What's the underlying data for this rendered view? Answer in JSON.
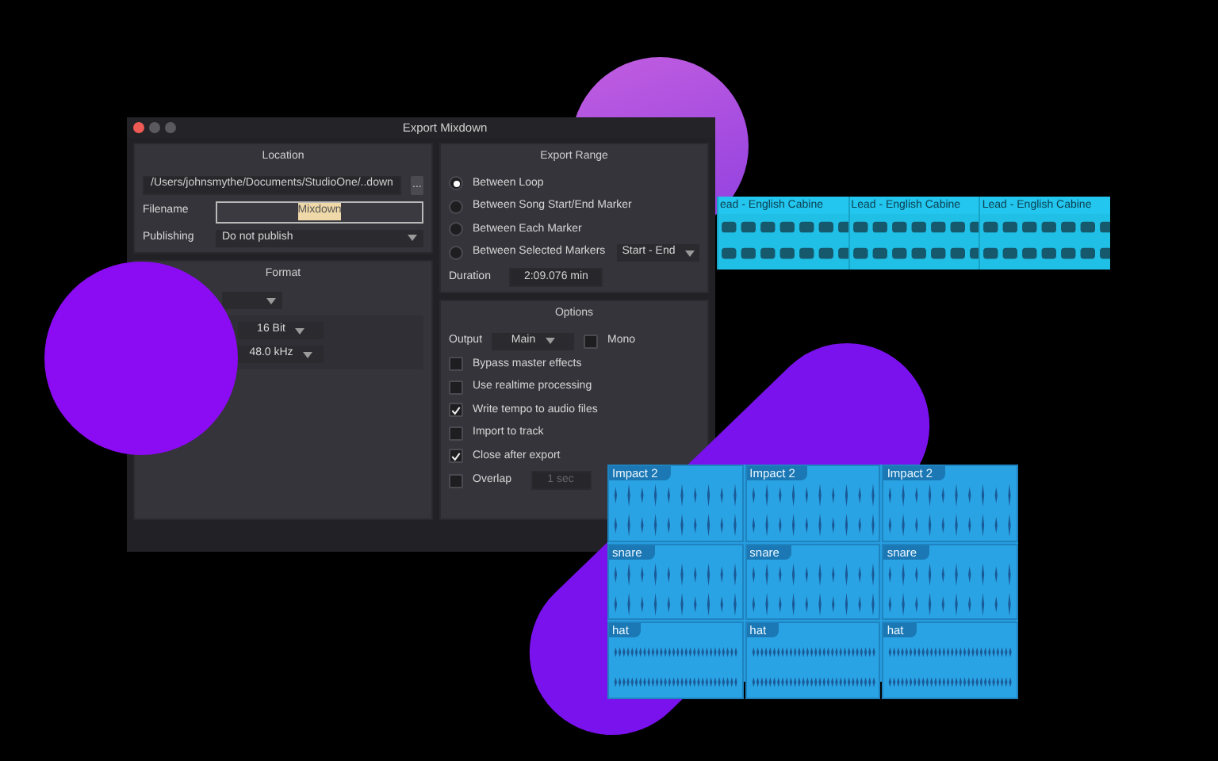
{
  "window": {
    "title": "Export Mixdown"
  },
  "location": {
    "title": "Location",
    "path": "/Users/johnsmythe/Documents/StudioOne/..down",
    "browse_label": "...",
    "filename_label": "Filename",
    "filename": "Mixdown",
    "publishing_label": "Publishing",
    "publishing": "Do not publish"
  },
  "format": {
    "title": "Format",
    "selects": [
      "16 Bit",
      "48.0 kHz"
    ]
  },
  "export_range": {
    "title": "Export Range",
    "options": [
      {
        "label": "Between Loop",
        "selected": true
      },
      {
        "label": "Between Song Start/End Marker",
        "selected": false
      },
      {
        "label": "Between Each Marker",
        "selected": false
      },
      {
        "label": "Between Selected Markers",
        "selected": false
      }
    ],
    "markers_select": "Start - End",
    "duration_label": "Duration",
    "duration": "2:09.076 min"
  },
  "options": {
    "title": "Options",
    "output_label": "Output",
    "output": "Main",
    "mono": {
      "label": "Mono",
      "checked": false
    },
    "checks": [
      {
        "label": "Bypass master effects",
        "checked": false
      },
      {
        "label": "Use realtime processing",
        "checked": false
      },
      {
        "label": "Write tempo to audio files",
        "checked": true
      },
      {
        "label": "Import to track",
        "checked": false
      },
      {
        "label": "Close after export",
        "checked": true
      }
    ],
    "overlap": {
      "label": "Overlap",
      "checked": false,
      "value": "1 sec",
      "disabled": true
    }
  },
  "top_clips": [
    {
      "label": "ead - English Cabine"
    },
    {
      "label": "Lead - English Cabine"
    },
    {
      "label": "Lead - English Cabine"
    }
  ],
  "bottom_tracks": [
    {
      "clips": [
        {
          "label": "Impact 2"
        },
        {
          "label": "Impact 2"
        },
        {
          "label": "Impact 2"
        }
      ]
    },
    {
      "clips": [
        {
          "label": "snare"
        },
        {
          "label": "snare"
        },
        {
          "label": "snare"
        }
      ]
    },
    {
      "clips": [
        {
          "label": "hat"
        },
        {
          "label": "hat"
        },
        {
          "label": "hat"
        }
      ]
    }
  ]
}
